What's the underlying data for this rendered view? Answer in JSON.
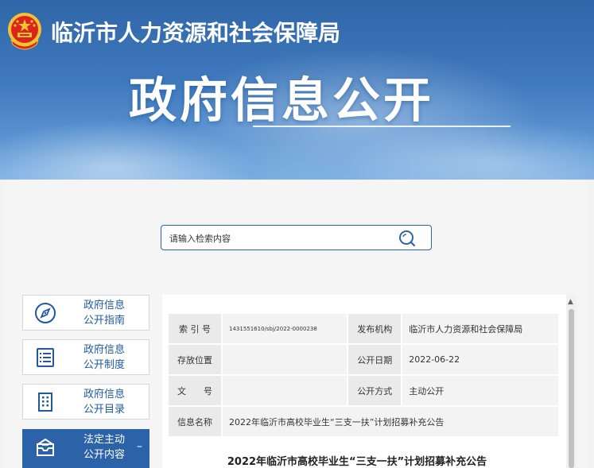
{
  "header": {
    "org_name": "临沂市人力资源和社会保障局",
    "main_title": "政府信息公开"
  },
  "search": {
    "placeholder": "请输入检索内容"
  },
  "sidebar": {
    "items": [
      {
        "label": "政府信息公开指南",
        "line1": "政府信息",
        "line2": "公开指南",
        "icon": "compass-icon"
      },
      {
        "label": "政府信息公开制度",
        "line1": "政府信息",
        "line2": "公开制度",
        "icon": "document-list-icon"
      },
      {
        "label": "政府信息公开目录",
        "line1": "政府信息",
        "line2": "公开目录",
        "icon": "building-icon"
      },
      {
        "label": "法定主动公开内容",
        "line1": "法定主动",
        "line2": "公开内容",
        "icon": "inbox-icon",
        "active": true,
        "toggle": "–"
      }
    ]
  },
  "meta": {
    "index_label": "索 引 号",
    "index_value": "1431551610/sbj/2022-0000238",
    "publisher_label": "发布机构",
    "publisher_value": "临沂市人力资源和社会保障局",
    "location_label": "存放位置",
    "location_value": "",
    "date_label": "公开日期",
    "date_value": "2022-06-22",
    "doc_no_label": "文　　号",
    "doc_no_value": "",
    "method_label": "公开方式",
    "method_value": "主动公开",
    "name_label": "信息名称",
    "name_value": "2022年临沂市高校毕业生“三支一扶”计划招募补充公告"
  },
  "document": {
    "title": "2022年临沂市高校毕业生“三支一扶”计划招募补充公告"
  },
  "colors": {
    "brand_blue": "#2c63a8",
    "banner_top": "#2f66a8",
    "emblem_red": "#d8251d",
    "emblem_gold": "#f3c232"
  }
}
